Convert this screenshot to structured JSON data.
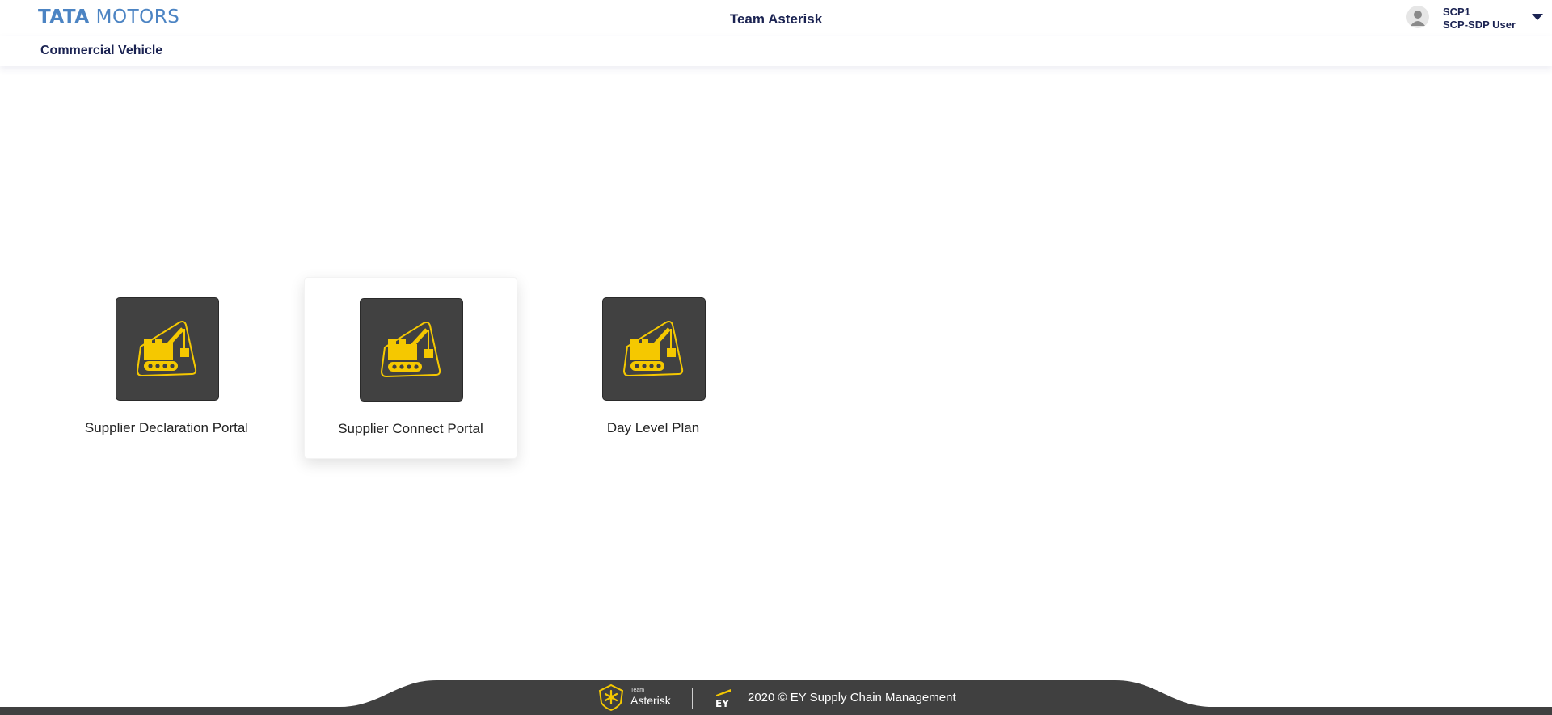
{
  "header": {
    "logo_part1": "TATA",
    "logo_part2": "MOTORS",
    "center_title": "Team Asterisk",
    "user": {
      "name": "SCP1",
      "role": "SCP-SDP User"
    }
  },
  "subheader": {
    "title": "Commercial Vehicle"
  },
  "tiles": [
    {
      "label": "Supplier Declaration Portal",
      "icon": "crane-truck-icon",
      "selected": false
    },
    {
      "label": "Supplier Connect Portal",
      "icon": "crane-truck-icon",
      "selected": true
    },
    {
      "label": "Day Level Plan",
      "icon": "crane-truck-icon",
      "selected": false
    }
  ],
  "footer": {
    "team_small": "Team",
    "team_big": "Asterisk",
    "ey_logo": "EY",
    "copyright": "2020 © EY Supply Chain Management"
  },
  "colors": {
    "brand_blue": "#4c84c3",
    "navy_text": "#1b2352",
    "tile_icon_bg": "#414141",
    "icon_yellow": "#f5c800",
    "footer_bg": "#404040"
  }
}
